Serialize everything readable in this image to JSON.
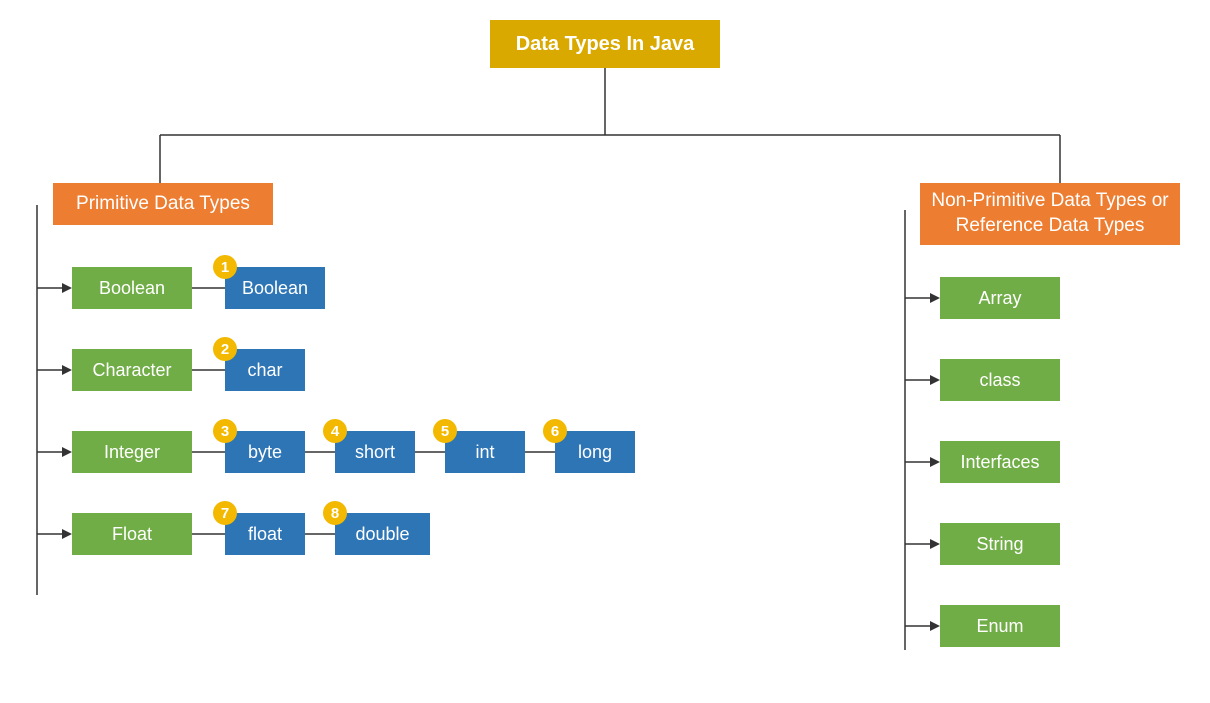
{
  "title": "Data Types In Java",
  "primitive": {
    "header": "Primitive Data Types",
    "categories": {
      "boolean": "Boolean",
      "character": "Character",
      "integer": "Integer",
      "float": "Float"
    },
    "types": {
      "boolean": "Boolean",
      "char": "char",
      "byte": "byte",
      "short": "short",
      "int": "int",
      "long": "long",
      "float": "float",
      "double": "double"
    },
    "badges": {
      "boolean": "1",
      "char": "2",
      "byte": "3",
      "short": "4",
      "int": "5",
      "long": "6",
      "float": "7",
      "double": "8"
    }
  },
  "nonprimitive": {
    "header": "Non-Primitive Data Types or Reference Data Types",
    "items": {
      "array": "Array",
      "class": "class",
      "interfaces": "Interfaces",
      "string": "String",
      "enum": "Enum"
    }
  }
}
